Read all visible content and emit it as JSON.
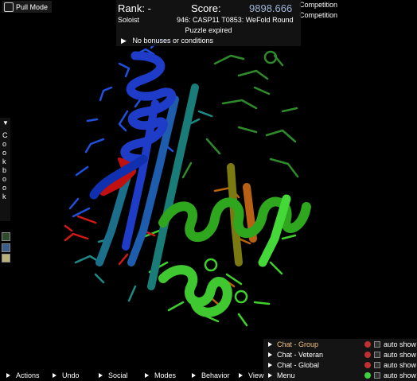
{
  "pull_mode": {
    "label": "Pull Mode"
  },
  "score_panel": {
    "rank": "Rank: -",
    "score_label": "Score:",
    "score_value": "9898.666",
    "player_mode": "Soloist",
    "puzzle_name": "946: CASP11 T0853: WeFold Round",
    "status": "Puzzle expired",
    "conditions": "No bonuses or conditions"
  },
  "competition": [
    "Competition",
    "Competition"
  ],
  "cookbook": {
    "label": "Cookbook"
  },
  "chat": [
    {
      "name": "Chat - Group",
      "color": "#f0c080",
      "led": "#c03030",
      "auto": "auto show"
    },
    {
      "name": "Chat - Veteran",
      "color": "#ffffff",
      "led": "#c03030",
      "auto": "auto show"
    },
    {
      "name": "Chat - Global",
      "color": "#ffffff",
      "led": "#c03030",
      "auto": "auto show"
    },
    {
      "name": "Menu",
      "color": "#ffffff",
      "led": "#40d040",
      "auto": "auto show"
    }
  ],
  "bottom_menu": [
    "Actions",
    "Undo",
    "Social",
    "Modes",
    "Behavior",
    "View"
  ],
  "colors": {
    "blue": "#1e3cc8",
    "teal": "#1a7c78",
    "green": "#30b020",
    "lime": "#44d838",
    "olive": "#7a7a10",
    "orange": "#b86014",
    "red": "#c01010"
  }
}
